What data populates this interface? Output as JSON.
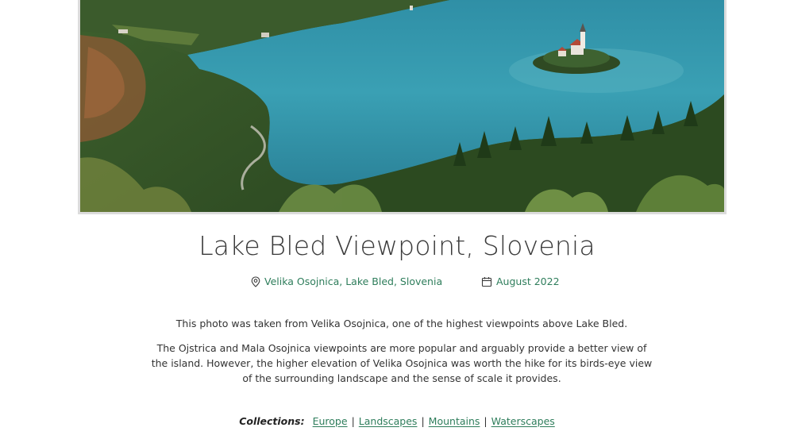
{
  "photo": {
    "alt": "Aerial view of Lake Bled with its island church"
  },
  "title": "Lake Bled Viewpoint, Slovenia",
  "meta": {
    "location": "Velika Osojnica, Lake Bled, Slovenia",
    "location_icon": "map-pin-icon",
    "date": "August 2022",
    "date_icon": "calendar-icon",
    "accent_color": "#2e7d5b"
  },
  "description": {
    "paragraph_1": "This photo was taken from Velika Osojnica, one of the highest viewpoints above Lake Bled.",
    "paragraph_2": "The Ojstrica and Mala Osojnica viewpoints are more popular and arguably provide a better view of the island. However, the higher elevation of Velika Osojnica was worth the hike for its birds-eye view of the surrounding landscape and the sense of scale it provides."
  },
  "collections": {
    "label": "Collections:",
    "items": [
      "Europe",
      "Landscapes",
      "Mountains",
      "Waterscapes"
    ]
  }
}
